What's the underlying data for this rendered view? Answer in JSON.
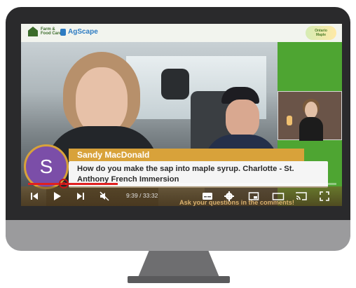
{
  "header": {
    "logo_left_line1": "Farm &",
    "logo_left_line2": "Food Care",
    "logo_center": "AgScape",
    "logo_right_line1": "Ontario",
    "logo_right_line2": "Maple"
  },
  "comment": {
    "author": "Sandy MacDonald",
    "avatar_letter": "S",
    "text": "How do you make the sap into maple syrup. Charlotte - St. Anthony French Immersion"
  },
  "player": {
    "time": "9:39 / 33:32",
    "progress": 0.29,
    "ticker": "Ask your questions in the comments!"
  },
  "icons": {
    "previous": "skip-previous-icon",
    "play": "play-icon",
    "next": "skip-next-icon",
    "mute": "volume-muted-icon",
    "captions": "captions-icon",
    "settings": "gear-icon",
    "miniplayer": "miniplayer-icon",
    "theater": "theater-mode-icon",
    "cast": "cast-icon",
    "fullscreen": "fullscreen-icon"
  },
  "colors": {
    "brand_green": "#4ea532",
    "accent_orange": "#d8a23a",
    "progress_red": "#e02020",
    "avatar_purple": "#7b4ea8"
  }
}
